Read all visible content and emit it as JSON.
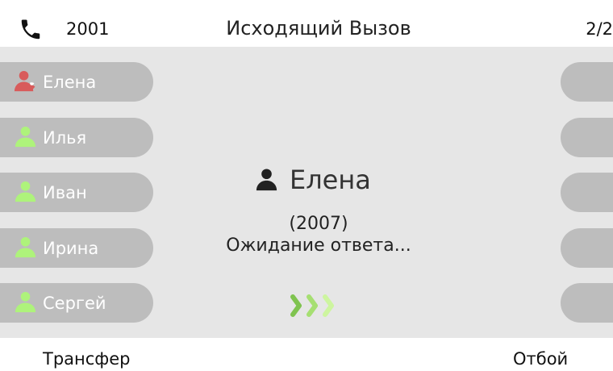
{
  "header": {
    "line": "2001",
    "title": "Исходящий Вызов",
    "page": "2/2",
    "phone_icon": "phone-icon"
  },
  "contacts": [
    {
      "label": "Елена",
      "icon": "person-busy-icon",
      "icon_color": "#d85b5b"
    },
    {
      "label": "Илья",
      "icon": "person-icon",
      "icon_color": "#aef37b"
    },
    {
      "label": "Иван",
      "icon": "person-icon",
      "icon_color": "#aef37b"
    },
    {
      "label": "Ирина",
      "icon": "person-icon",
      "icon_color": "#aef37b"
    },
    {
      "label": "Сергей",
      "icon": "person-icon",
      "icon_color": "#aef37b"
    }
  ],
  "call": {
    "name": "Елена",
    "number": "(2007)",
    "status": "Ожидание ответа...",
    "person_icon": "person-icon",
    "progress_icon": "chevron-right-icon"
  },
  "softkeys": {
    "left": "Трансфер",
    "right": "Отбой"
  },
  "colors": {
    "screen_background": "#e6e6e6",
    "slot_background": "#bdbdbd",
    "available_green": "#aef37b",
    "busy_red": "#d85b5b",
    "progress_green_dark": "#7fc34f",
    "progress_green_mid": "#a6df72",
    "progress_green_light": "#cdf59f"
  }
}
